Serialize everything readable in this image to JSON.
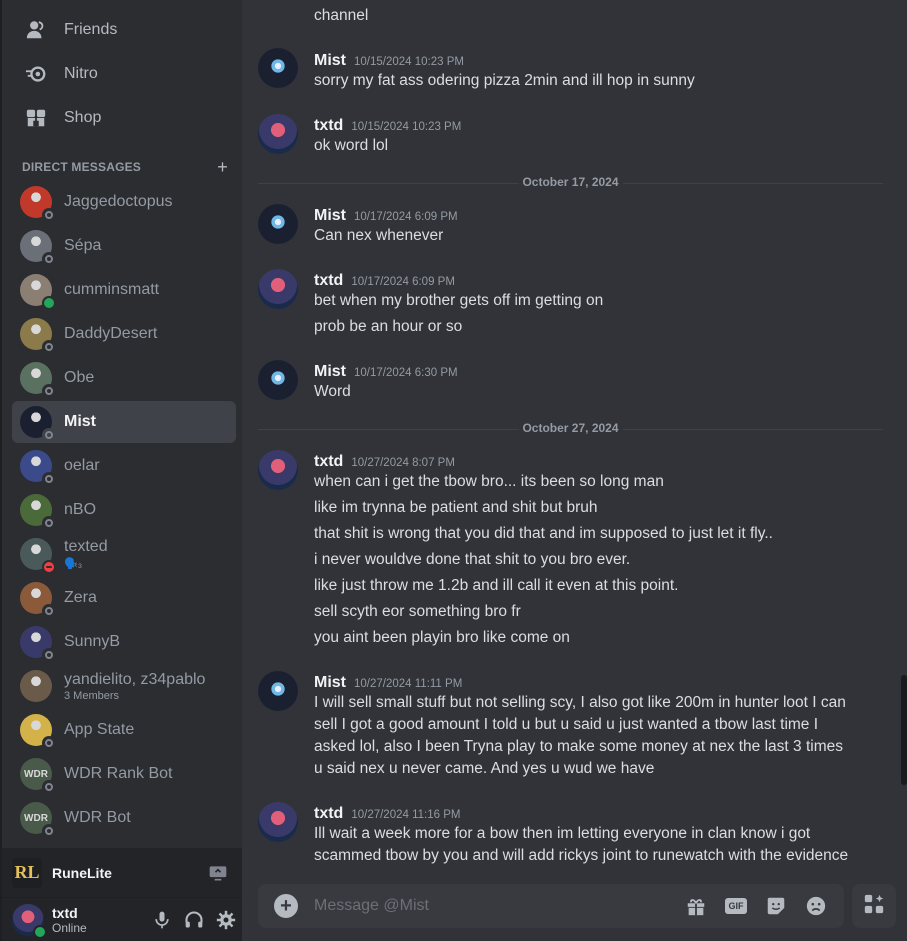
{
  "sidebar": {
    "nav": [
      {
        "label": "Friends",
        "icon": "friends-icon"
      },
      {
        "label": "Nitro",
        "icon": "nitro-icon"
      },
      {
        "label": "Shop",
        "icon": "shop-icon"
      }
    ],
    "dm_header": {
      "label": "DIRECT MESSAGES",
      "add": "+"
    },
    "dms": [
      {
        "name": "Jaggedoctopus",
        "status": "offline",
        "color": "#c0392b"
      },
      {
        "name": "Sépa",
        "status": "offline",
        "color": "#6b6f78"
      },
      {
        "name": "cumminsmatt",
        "status": "online",
        "color": "#8a7f72"
      },
      {
        "name": "DaddyDesert",
        "status": "offline",
        "color": "#8b7a4a"
      },
      {
        "name": "Obe",
        "status": "offline",
        "color": "#5a7060"
      },
      {
        "name": "Mist",
        "status": "offline",
        "color": "#1a2030",
        "active": true
      },
      {
        "name": "oelar",
        "status": "offline",
        "color": "#3b4a8a"
      },
      {
        "name": "nBO",
        "status": "offline",
        "color": "#4a6a3a"
      },
      {
        "name": "texted",
        "status": "dnd",
        "sub": "🗣️₃",
        "color": "#4a5a5a"
      },
      {
        "name": "Zera",
        "status": "offline",
        "color": "#8a5a3a"
      },
      {
        "name": "SunnyB",
        "status": "offline",
        "color": "#3a3a6a"
      },
      {
        "name": "yandielito, z34pablo",
        "status": "group",
        "sub": "3 Members",
        "color": "#6a5a4a"
      },
      {
        "name": "App State",
        "status": "offline",
        "color": "#d4b24a"
      },
      {
        "name": "WDR Rank Bot",
        "status": "offline",
        "color": "#4a5a4a",
        "badge": "WDR"
      },
      {
        "name": "WDR Bot",
        "status": "offline",
        "color": "#4a5a4a",
        "badge": "WDR"
      }
    ],
    "activity": {
      "name": "RuneLite",
      "logo": "RL"
    },
    "user": {
      "name": "txtd",
      "status": "Online"
    }
  },
  "chat": {
    "top_fragment": "channel",
    "dividers": [
      "October 17, 2024",
      "October 27, 2024"
    ],
    "messages": [
      {
        "author": "Mist",
        "time": "10/15/2024 10:23 PM",
        "lines": [
          "sorry my fat ass odering pizza 2min and ill hop in sunny"
        ]
      },
      {
        "author": "txtd",
        "time": "10/15/2024 10:23 PM",
        "lines": [
          "ok word lol"
        ]
      },
      {
        "author": "Mist",
        "time": "10/17/2024 6:09 PM",
        "lines": [
          "Can nex whenever"
        ]
      },
      {
        "author": "txtd",
        "time": "10/17/2024 6:09 PM",
        "lines": [
          "bet when my brother gets off im getting on",
          "prob be an hour or so"
        ]
      },
      {
        "author": "Mist",
        "time": "10/17/2024 6:30 PM",
        "lines": [
          "Word"
        ]
      },
      {
        "author": "txtd",
        "time": "10/27/2024 8:07 PM",
        "lines": [
          "when can i get the tbow bro... its been so long man",
          "like im trynna be patient and shit but bruh",
          "that shit is wrong that you did that and im supposed to just let it fly..",
          "i never wouldve done that shit to you bro ever.",
          "like just throw me 1.2b and ill call it even at this point.",
          "sell scyth eor something bro fr",
          "you aint been playin bro like come on"
        ]
      },
      {
        "author": "Mist",
        "time": "10/27/2024 11:11 PM",
        "lines": [
          "I will sell small stuff but not selling scy, I also got like 200m in hunter loot I can sell I got a good amount I told u but u said u just wanted a tbow last time I asked lol, also I been Tryna play to make some money at nex  the last 3 times u said nex u never came. And yes u wud we have"
        ]
      },
      {
        "author": "txtd",
        "time": "10/27/2024 11:16 PM",
        "lines": [
          "Ill wait a week more for a bow then im letting everyone in clan know i got scammed tbow by you and will add rickys joint to runewatch with the evidence"
        ]
      }
    ],
    "composer": {
      "placeholder": "Message @Mist",
      "gif_label": "GIF"
    }
  },
  "colors": {
    "background": "#313338",
    "sidebar": "#2b2d31",
    "active": "#404249",
    "online": "#23a55a",
    "dnd": "#f23f43"
  }
}
